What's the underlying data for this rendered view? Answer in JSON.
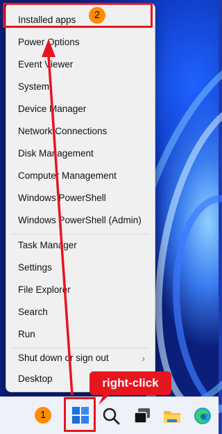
{
  "menu": {
    "items": [
      {
        "label": "Installed apps"
      },
      {
        "label": "Power Options"
      },
      {
        "label": "Event Viewer"
      },
      {
        "label": "System"
      },
      {
        "label": "Device Manager"
      },
      {
        "label": "Network Connections"
      },
      {
        "label": "Disk Management"
      },
      {
        "label": "Computer Management"
      },
      {
        "label": "Windows PowerShell"
      },
      {
        "label": "Windows PowerShell (Admin)"
      },
      {
        "label": "Task Manager"
      },
      {
        "label": "Settings"
      },
      {
        "label": "File Explorer"
      },
      {
        "label": "Search"
      },
      {
        "label": "Run"
      },
      {
        "label": "Shut down or sign out"
      },
      {
        "label": "Desktop"
      }
    ],
    "submenu_icon": "chevron-right-icon"
  },
  "annotations": {
    "step1": "1",
    "step2": "2",
    "callout": "right-click",
    "accent_color": "#e8141e",
    "badge_color": "#ff8c00"
  },
  "taskbar": {
    "icons": [
      "windows-start-icon",
      "search-icon",
      "task-view-icon",
      "file-explorer-icon",
      "edge-icon"
    ]
  }
}
